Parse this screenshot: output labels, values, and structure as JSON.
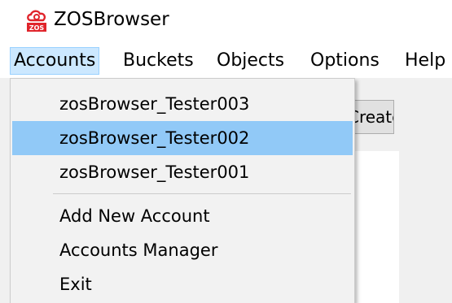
{
  "window": {
    "title": "ZOSBrowser",
    "logo_text": "ZOS",
    "logo_icon": "cloud-logo-icon"
  },
  "menubar": {
    "items": [
      {
        "label": "Accounts"
      },
      {
        "label": "Buckets"
      },
      {
        "label": "Objects"
      },
      {
        "label": "Options"
      },
      {
        "label": "Help"
      }
    ]
  },
  "background": {
    "button_label": "Create Bucket"
  },
  "accounts_menu": {
    "accounts": [
      {
        "label": "zosBrowser_Tester003"
      },
      {
        "label": "zosBrowser_Tester002",
        "highlighted": true
      },
      {
        "label": "zosBrowser_Tester001"
      }
    ],
    "actions": [
      {
        "label": "Add New Account"
      },
      {
        "label": "Accounts Manager"
      },
      {
        "label": "Exit"
      }
    ]
  },
  "colors": {
    "accent_red": "#e0242b",
    "highlight": "#91c9f7",
    "menu_open_bg": "#cce8ff"
  }
}
